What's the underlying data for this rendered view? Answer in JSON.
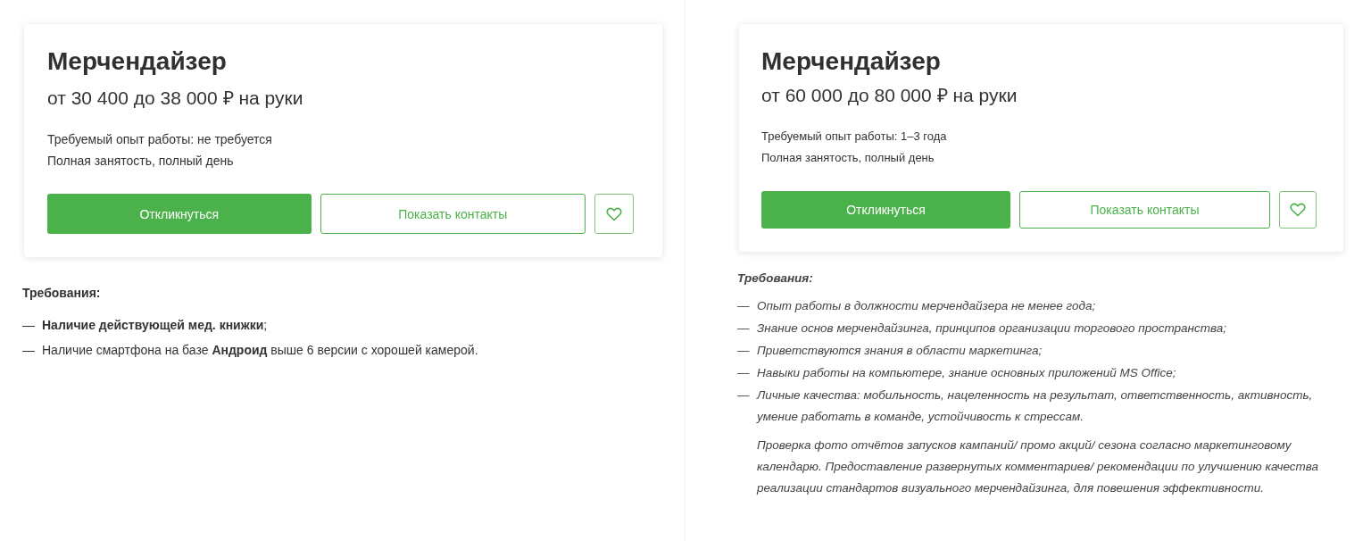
{
  "panels": [
    {
      "italic": false,
      "card": {
        "title": "Мерчендайзер",
        "salary": "от 30 400 до 38 000 ₽ на руки",
        "experience": "Требуемый опыт работы: не требуется",
        "employment": "Полная занятость, полный день",
        "respond_button": "Откликнуться",
        "contacts_button": "Показать контакты"
      },
      "requirements_heading": "Требования:",
      "requirements": [
        {
          "marker": "—",
          "text": "**Наличие действующей мед. книжки**;"
        },
        {
          "marker": "—",
          "text": "Наличие смартфона на базе **Андроид** выше 6 версии с хорошей камерой."
        }
      ]
    },
    {
      "italic": true,
      "card": {
        "title": "Мерчендайзер",
        "salary": "от 60 000 до 80 000 ₽ на руки",
        "experience": "Требуемый опыт работы: 1–3 года",
        "employment": "Полная занятость, полный день",
        "respond_button": "Откликнуться",
        "contacts_button": "Показать контакты"
      },
      "requirements_heading": "Требования:",
      "requirements": [
        {
          "marker": "—",
          "text": "Опыт работы в должности мерчендайзера не менее года;"
        },
        {
          "marker": "—",
          "text": "Знание основ мерчендайзинга, принципов организации торгового пространства;"
        },
        {
          "marker": "—",
          "text": "Приветствуются знания в области маркетинга;"
        },
        {
          "marker": "—",
          "text": "Навыки работы на компьютере, знание основных приложений MS Office;"
        },
        {
          "marker": "—",
          "text": "Личные качества: мобильность, нацеленность на результат, ответственность, активность, умение работать в команде, устойчивость к стрессам."
        },
        {
          "text": "Проверка фото отчётов запусков кампаний/ промо акций/ сезона согласно маркетинговому календарю. Предоставление развернутых комментариев/ рекомендации по улучшению качества реализации стандартов визуального мерчендайзинга, для повешения эффективности."
        }
      ]
    }
  ]
}
